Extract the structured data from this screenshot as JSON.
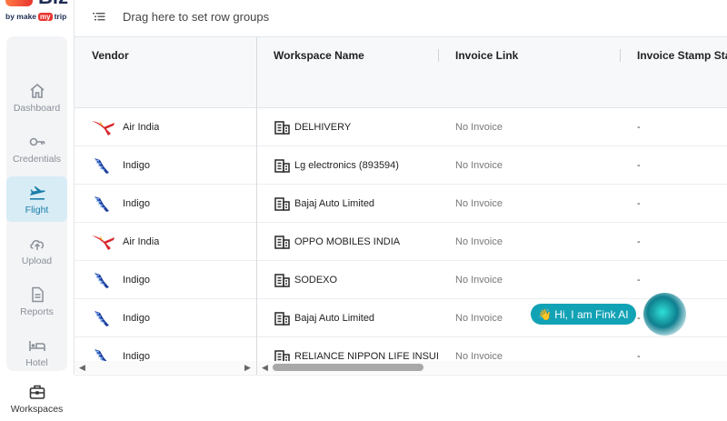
{
  "brand": {
    "name": "Biz",
    "byline_prefix": "by make",
    "byline_mark": "my",
    "byline_suffix": "trip"
  },
  "sidebar": {
    "items": [
      {
        "label": "Dashboard",
        "icon": "home-icon",
        "active": false
      },
      {
        "label": "Credentials",
        "icon": "key-icon",
        "active": false
      },
      {
        "label": "Flight",
        "icon": "plane-icon",
        "active": true
      },
      {
        "label": "Upload",
        "icon": "cloud-upload-icon",
        "active": false
      },
      {
        "label": "Reports",
        "icon": "document-icon",
        "active": false
      },
      {
        "label": "Hotel",
        "icon": "bed-icon",
        "active": false
      },
      {
        "label": "Workspaces",
        "icon": "briefcase-icon",
        "active": false
      }
    ]
  },
  "grid": {
    "group_bar_text": "Drag here to set row groups",
    "columns": [
      "Vendor",
      "Workspace Name",
      "Invoice Link",
      "Invoice Stamp Sta"
    ],
    "rows": [
      {
        "vendor": "Air India",
        "vendor_logo": "air-india-logo",
        "workspace": "DELHIVERY",
        "invoice": "No Invoice",
        "stamp": "-"
      },
      {
        "vendor": "Indigo",
        "vendor_logo": "indigo-logo",
        "workspace": "Lg electronics (893594)",
        "invoice": "No Invoice",
        "stamp": "-"
      },
      {
        "vendor": "Indigo",
        "vendor_logo": "indigo-logo",
        "workspace": "Bajaj Auto Limited",
        "invoice": "No Invoice",
        "stamp": "-"
      },
      {
        "vendor": "Air India",
        "vendor_logo": "air-india-logo",
        "workspace": "OPPO MOBILES INDIA",
        "invoice": "No Invoice",
        "stamp": "-"
      },
      {
        "vendor": "Indigo",
        "vendor_logo": "indigo-logo",
        "workspace": "SODEXO",
        "invoice": "No Invoice",
        "stamp": "-"
      },
      {
        "vendor": "Indigo",
        "vendor_logo": "indigo-logo",
        "workspace": "Bajaj Auto Limited",
        "invoice": "No Invoice",
        "stamp": "-"
      },
      {
        "vendor": "Indigo",
        "vendor_logo": "indigo-logo",
        "workspace": "RELIANCE NIPPON LIFE INSUI",
        "invoice": "No Invoice",
        "stamp": "-"
      }
    ]
  },
  "chat": {
    "greeting": "👋 Hi, I am Fink AI"
  },
  "colors": {
    "accent": "#1a7fa8",
    "active_bg": "#d8ecf6",
    "chat": "#12a2b5",
    "air_india_red": "#d7262b",
    "indigo_blue": "#1d3f9a"
  }
}
